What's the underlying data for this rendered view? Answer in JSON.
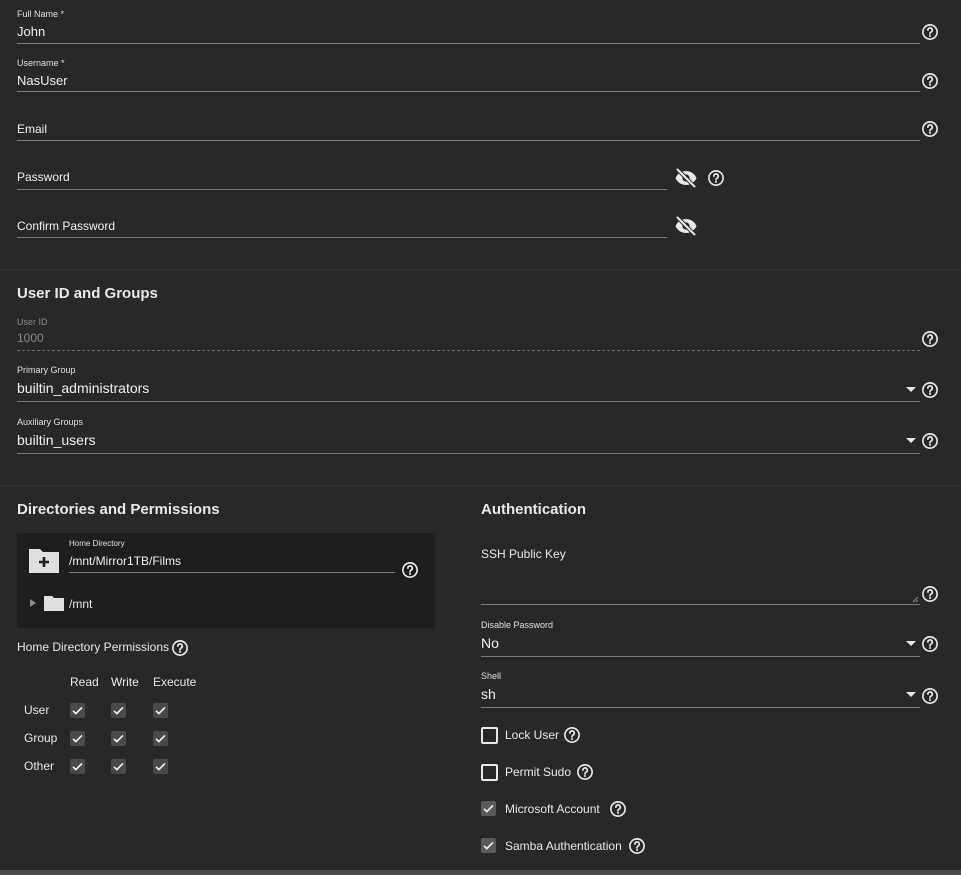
{
  "identification": {
    "full_name": {
      "label": "Full Name *",
      "value": "John"
    },
    "username": {
      "label": "Username *",
      "value": "NasUser"
    },
    "email": {
      "label": "Email",
      "value": ""
    },
    "password": {
      "label": "Password",
      "value": ""
    },
    "confirm_password": {
      "label": "Confirm Password",
      "value": ""
    }
  },
  "user_id_groups": {
    "title": "User ID and Groups",
    "user_id": {
      "label": "User ID",
      "value": "1000"
    },
    "primary_group": {
      "label": "Primary Group",
      "value": "builtin_administrators"
    },
    "auxiliary_groups": {
      "label": "Auxiliary Groups",
      "value": "builtin_users"
    }
  },
  "directories": {
    "title": "Directories and Permissions",
    "home_directory": {
      "label": "Home Directory",
      "value": "/mnt/Mirror1TB/Films"
    },
    "tree_root": "/mnt",
    "permissions": {
      "title": "Home Directory Permissions",
      "columns": [
        "Read",
        "Write",
        "Execute"
      ],
      "rows": [
        {
          "name": "User",
          "values": [
            true,
            true,
            true
          ]
        },
        {
          "name": "Group",
          "values": [
            true,
            true,
            true
          ]
        },
        {
          "name": "Other",
          "values": [
            true,
            true,
            true
          ]
        }
      ]
    }
  },
  "authentication": {
    "title": "Authentication",
    "ssh_public_key": {
      "label": "SSH Public Key",
      "value": ""
    },
    "disable_password": {
      "label": "Disable Password",
      "value": "No"
    },
    "shell": {
      "label": "Shell",
      "value": "sh"
    },
    "checkboxes": [
      {
        "label": "Lock User",
        "checked": false
      },
      {
        "label": "Permit Sudo",
        "checked": false
      },
      {
        "label": "Microsoft Account",
        "checked": true
      },
      {
        "label": "Samba Authentication",
        "checked": true
      }
    ]
  },
  "icons": {
    "help": "help-circle-icon",
    "eye": "eye-off-icon",
    "folder_add": "folder-plus-icon",
    "folder": "folder-icon",
    "caret": "dropdown-caret-icon"
  },
  "colors": {
    "background": "#282828",
    "panel": "#1e1e1e",
    "text": "#e8e8e8"
  }
}
